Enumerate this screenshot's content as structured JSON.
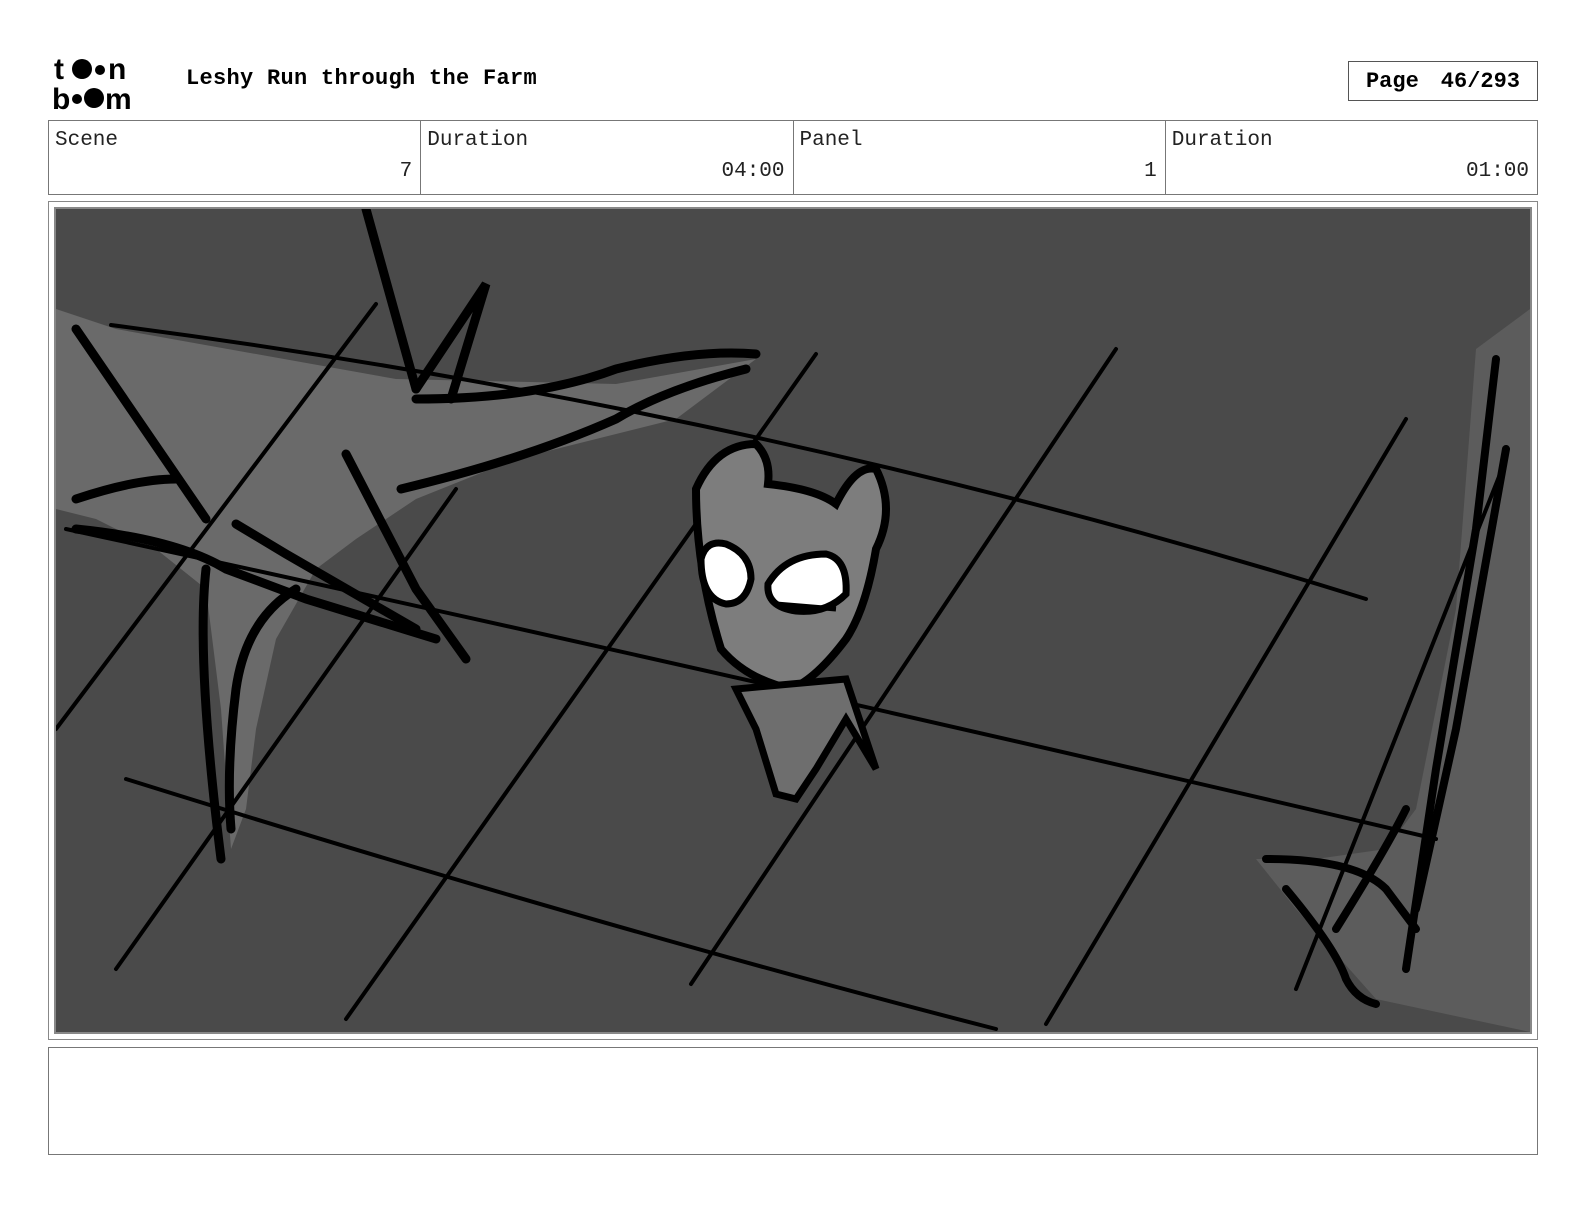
{
  "header": {
    "logo_text": "toonboom",
    "title": "Leshy Run through the Farm",
    "page_label": "Page",
    "page_value": "46/293"
  },
  "info": [
    {
      "label": "Scene",
      "value": "7"
    },
    {
      "label": "Duration",
      "value": "04:00"
    },
    {
      "label": "Panel",
      "value": "1"
    },
    {
      "label": "Duration",
      "value": "01:00"
    }
  ],
  "notes": {
    "text": ""
  }
}
